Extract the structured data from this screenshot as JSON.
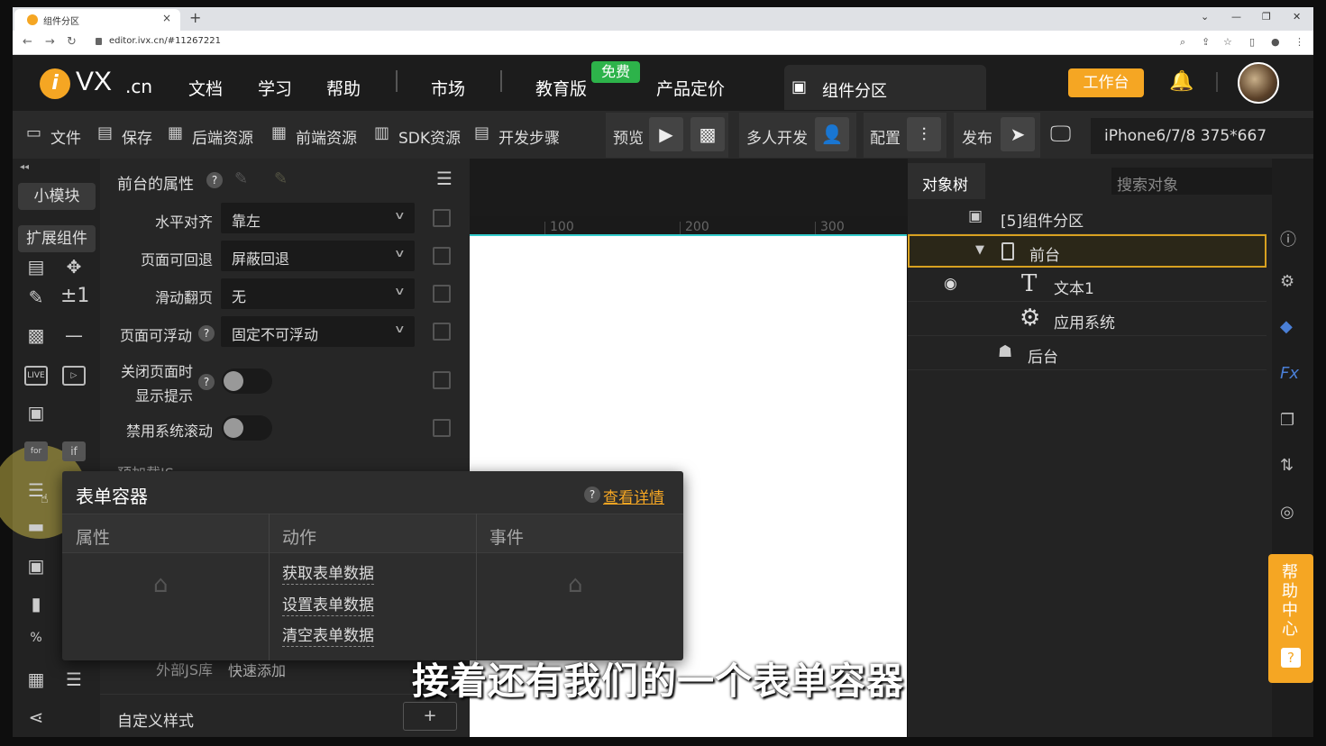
{
  "browser": {
    "tab_title": "组件分区",
    "url": "editor.ivx.cn/#11267221",
    "new_tab": "+",
    "tab_close": "×"
  },
  "header": {
    "logo_letter": "i",
    "logo_text": "VX",
    "logo_suffix": ".cn",
    "nav": [
      "文档",
      "学习",
      "帮助",
      "市场",
      "教育版",
      "产品定价"
    ],
    "free_badge": "免费",
    "active_tab": "组件分区",
    "workbench_button": "工作台"
  },
  "toolbar": {
    "file": "文件",
    "save": "保存",
    "backend_res": "后端资源",
    "frontend_res": "前端资源",
    "sdk_res": "SDK资源",
    "dev_steps": "开发步骤",
    "preview": "预览",
    "multi_dev": "多人开发",
    "config": "配置",
    "publish": "发布",
    "device": "iPhone6/7/8 375*667"
  },
  "left_panel": {
    "tab_small_module": "小模块",
    "tab_ext_component": "扩展组件",
    "for_label": "for",
    "if_label": "if",
    "live_label": "LIVE",
    "plus_minus": "±1",
    "percent": "%"
  },
  "properties": {
    "title": "前台的属性",
    "rows": [
      {
        "label": "水平对齐",
        "value": "靠左"
      },
      {
        "label": "页面可回退",
        "value": "屏蔽回退"
      },
      {
        "label": "滑动翻页",
        "value": "无"
      },
      {
        "label": "页面可浮动",
        "value": "固定不可浮动"
      }
    ],
    "toggle1_label_line1": "关闭页面时",
    "toggle1_label_line2": "显示提示",
    "toggle2_label": "禁用系统滚动",
    "partial_label": "预加载JS",
    "ext_js_label": "外部JS库",
    "ext_js_value": "快速添加",
    "custom_style": "自定义样式",
    "add": "+"
  },
  "ruler": [
    "100",
    "200",
    "300"
  ],
  "object_tree": {
    "tab": "对象树",
    "search_placeholder": "搜索对象",
    "nodes": [
      {
        "label": "[5]组件分区"
      },
      {
        "label": "前台"
      },
      {
        "label": "文本1"
      },
      {
        "label": "应用系统"
      },
      {
        "label": "后台"
      }
    ]
  },
  "right_rail": {
    "help_center": "帮助中心",
    "help_q": "?",
    "fx": "Fx"
  },
  "popup": {
    "title": "表单容器",
    "detail_link": "查看详情",
    "columns": [
      "属性",
      "动作",
      "事件"
    ],
    "actions": [
      "获取表单数据",
      "设置表单数据",
      "清空表单数据"
    ]
  },
  "subtitle": "接着还有我们的一个表单容器"
}
